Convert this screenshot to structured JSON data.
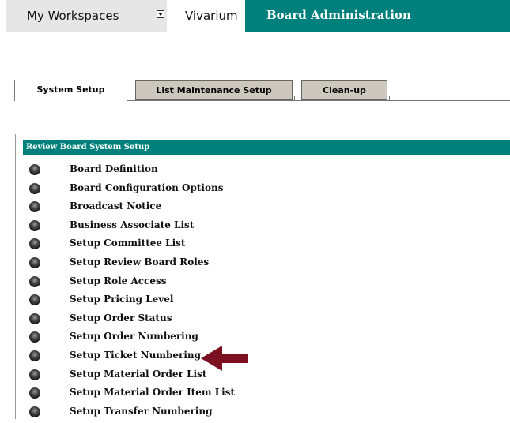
{
  "topnav": {
    "workspaces_label": "My Workspaces",
    "vivarium_label": "Vivarium",
    "board_admin_label": "Board Administration",
    "accent_color": "#00807c"
  },
  "subtabs": [
    {
      "label": "System Setup",
      "active": true
    },
    {
      "label": "List Maintenance Setup",
      "active": false
    },
    {
      "label": "Clean-up",
      "active": false
    }
  ],
  "panel": {
    "header": "Review Board System Setup",
    "items": [
      "Board Definition",
      "Board Configuration Options",
      "Broadcast Notice",
      "Business Associate List",
      "Setup Committee List",
      "Setup Review Board Roles",
      "Setup Role Access",
      "Setup Pricing Level",
      "Setup Order Status",
      "Setup Order Numbering",
      "Setup Ticket Numbering",
      "Setup Material Order List",
      "Setup Material Order Item List",
      "Setup Transfer Numbering"
    ]
  },
  "annotation": {
    "arrow_color": "#7a1020",
    "points_to": "Setup Ticket Numbering"
  }
}
